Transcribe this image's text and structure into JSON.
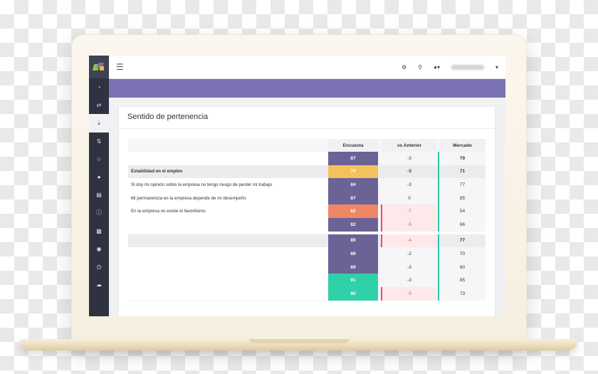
{
  "app": {
    "section_title": "Sentido de pertenencia"
  },
  "colors": {
    "purple": "#6b6396",
    "orange": "#f4c25c",
    "coral": "#ef8666",
    "teal": "#2fd1a8",
    "negative_bg": "#fde8ea",
    "accent_red": "#e74c6c",
    "accent_green": "#29c9a5",
    "band": "#7a72b2"
  },
  "sidebar": {
    "icons": [
      "pie-chart-icon",
      "swap-icon",
      "download-icon",
      "sort-icon",
      "trophy-icon",
      "comments-icon",
      "document-icon",
      "info-icon",
      "bar-chart-icon",
      "globe-icon",
      "clock-icon",
      "cloud-icon"
    ]
  },
  "table": {
    "headers": {
      "encuesta": "Encuesta",
      "anterior": "vs Anterior",
      "mercado": "Mercado"
    },
    "rows": [
      {
        "label": "",
        "encuesta": "87",
        "anterior": "-3",
        "mercado": "79",
        "enc_color": "purple",
        "neg": false,
        "type": "total"
      },
      {
        "label": "Estabilidad en el empleo",
        "encuesta": "79",
        "anterior": "-3",
        "mercado": "71",
        "enc_color": "orange",
        "neg": false,
        "type": "sect"
      },
      {
        "label": "Si doy mi opinión sobre la empresa no tengo riesgo de perder mi trabajo",
        "encuesta": "84",
        "anterior": "-3",
        "mercado": "77",
        "enc_color": "purple",
        "neg": false,
        "type": "item"
      },
      {
        "label": "Mi permanencia en la empresa depende de mi desempeño",
        "encuesta": "87",
        "anterior": "0",
        "mercado": "85",
        "enc_color": "purple",
        "neg": false,
        "type": "item"
      },
      {
        "label": "En la empresa no existe el favoritismo",
        "encuesta": "62",
        "anterior": "-7",
        "mercado": "54",
        "enc_color": "coral",
        "neg": true,
        "type": "item"
      },
      {
        "label": "",
        "encuesta": "82",
        "anterior": "-5",
        "mercado": "66",
        "enc_color": "purple",
        "neg": true,
        "type": "item"
      },
      {
        "label": "",
        "encuesta": "",
        "anterior": "",
        "mercado": "",
        "enc_color": "",
        "neg": false,
        "type": "spacer"
      },
      {
        "label": "",
        "encuesta": "89",
        "anterior": "-4",
        "mercado": "77",
        "enc_color": "purple",
        "neg": true,
        "type": "sect"
      },
      {
        "label": "",
        "encuesta": "89",
        "anterior": "-2",
        "mercado": "70",
        "enc_color": "purple",
        "neg": false,
        "type": "item"
      },
      {
        "label": "",
        "encuesta": "89",
        "anterior": "-3",
        "mercado": "80",
        "enc_color": "purple",
        "neg": false,
        "type": "item"
      },
      {
        "label": "",
        "encuesta": "91",
        "anterior": "-3",
        "mercado": "85",
        "enc_color": "teal",
        "neg": false,
        "type": "item"
      },
      {
        "label": "",
        "encuesta": "90",
        "anterior": "-5",
        "mercado": "73",
        "enc_color": "teal",
        "neg": true,
        "type": "item"
      }
    ]
  }
}
